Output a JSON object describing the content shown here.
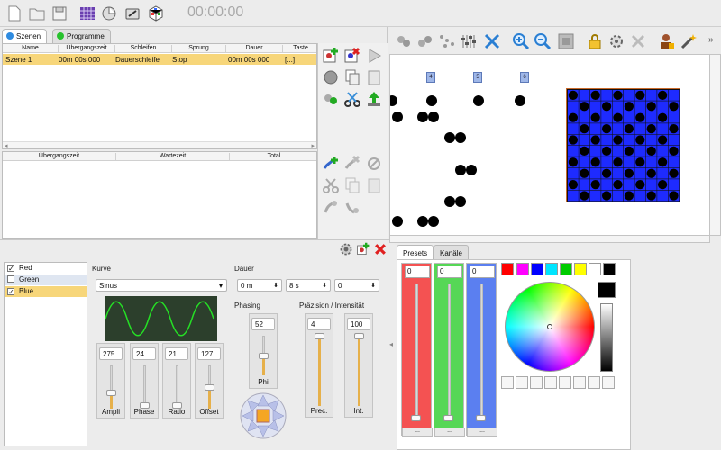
{
  "toolbar": {
    "icons": [
      "new-file-icon",
      "open-folder-icon",
      "save-icon",
      "fixture-grid-icon",
      "palette-icon",
      "tools-icon",
      "cube-icon"
    ],
    "timer": "00:00:00"
  },
  "scenes": {
    "tabs": [
      {
        "label": "Szenen",
        "color": "#2f8be0"
      },
      {
        "label": "Programme",
        "color": "#27c22d"
      }
    ],
    "columns": [
      "Name",
      "Übergangszeit",
      "Schleifen",
      "Sprung",
      "Dauer",
      "Taste"
    ],
    "rows": [
      {
        "name": "Szene 1",
        "transition": "00m 00s 000",
        "loop": "Dauerschleife",
        "jump": "Stop",
        "duration": "00m 00s 000",
        "key": "[...]"
      }
    ],
    "step_columns": [
      "Übergangszeit",
      "Wartezeit",
      "Total"
    ]
  },
  "stage": {
    "fixture_labels": [
      "4",
      "5",
      "6"
    ],
    "colors": {
      "blue": "#1e2bff",
      "matrix_border": "#c96a2a"
    }
  },
  "effect": {
    "channels": [
      {
        "label": "Red",
        "checked": true
      },
      {
        "label": "Green",
        "checked": false
      },
      {
        "label": "Blue",
        "checked": true
      }
    ],
    "curve_label": "Kurve",
    "curve_value": "Sinus",
    "duration_label": "Dauer",
    "duration_fields": [
      "0 m",
      "8 s",
      "0"
    ],
    "phasing_label": "Phasing",
    "precision_label": "Präzision / Intensität",
    "sliders": [
      {
        "name": "Ampli",
        "value": "275",
        "level": 0.37
      },
      {
        "name": "Phase",
        "value": "24",
        "level": 0.09
      },
      {
        "name": "Ratio",
        "value": "21",
        "level": 0.08
      },
      {
        "name": "Offset",
        "value": "127",
        "level": 0.5
      },
      {
        "name": "Phi",
        "value": "52",
        "level": 0.5
      },
      {
        "name": "Prec.",
        "value": "4",
        "level": 1.0
      },
      {
        "name": "Int.",
        "value": "100",
        "level": 1.0
      }
    ]
  },
  "color_panel": {
    "tabs": [
      "Presets",
      "Kanäle"
    ],
    "channels": [
      {
        "value": "0",
        "color": "#f45252"
      },
      {
        "value": "0",
        "color": "#56d756"
      },
      {
        "value": "0",
        "color": "#5b7ff0"
      }
    ],
    "more_label": "...",
    "swatches": [
      "#ff0000",
      "#ff00ff",
      "#0000ff",
      "#00e5ff",
      "#00cc00",
      "#ffff00",
      "#ffffff",
      "#000000"
    ]
  }
}
